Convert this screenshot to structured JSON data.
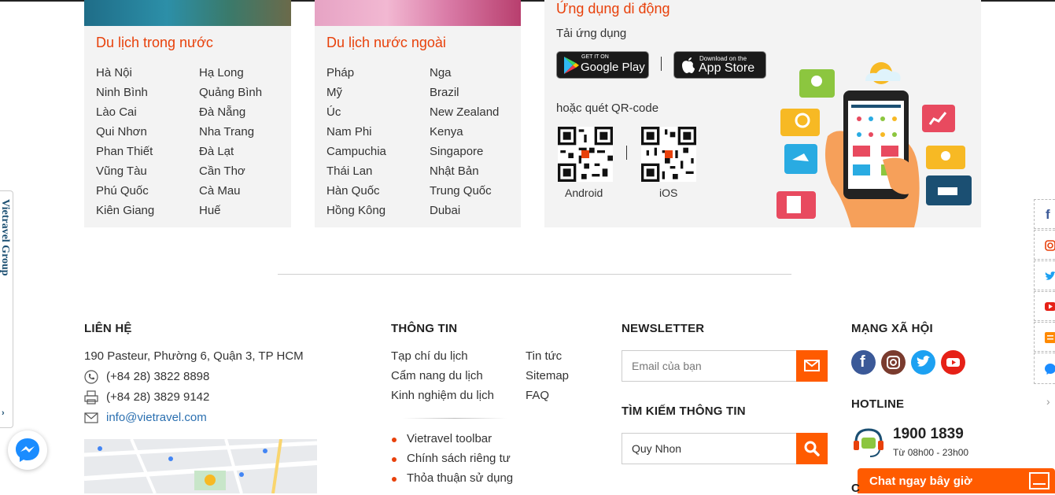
{
  "domestic": {
    "title": "Du lịch trong nước",
    "col1": [
      "Hà Nội",
      "Ninh Bình",
      "Lào Cai",
      "Qui Nhơn",
      "Phan Thiết",
      "Vũng Tàu",
      "Phú Quốc",
      "Kiên Giang"
    ],
    "col2": [
      "Hạ Long",
      "Quảng Bình",
      "Đà Nẵng",
      "Nha Trang",
      "Đà Lạt",
      "Cần Thơ",
      "Cà Mau",
      "Huế"
    ]
  },
  "international": {
    "title": "Du lịch nước ngoài",
    "col1": [
      "Pháp",
      "Mỹ",
      "Úc",
      "Nam Phi",
      "Campuchia",
      "Thái Lan",
      "Hàn Quốc",
      "Hồng Kông"
    ],
    "col2": [
      "Nga",
      "Brazil",
      "New Zealand",
      "Kenya",
      "Singapore",
      "Nhật Bản",
      "Trung Quốc",
      "Dubai"
    ]
  },
  "mobile": {
    "title": "Ứng dụng di động",
    "download_label": "Tải ứng dụng",
    "google_small": "GET IT ON",
    "google_big": "Google Play",
    "apple_small": "Download on the",
    "apple_big": "App Store",
    "qr_label": "hoặc quét QR-code",
    "android_label": "Android",
    "ios_label": "iOS"
  },
  "contact": {
    "heading": "LIÊN HỆ",
    "address": "190 Pasteur, Phường 6, Quận 3, TP HCM",
    "phone": "(+84 28) 3822 8898",
    "fax": "(+84 28) 3829 9142",
    "email": "info@vietravel.com"
  },
  "info": {
    "heading": "THÔNG TIN",
    "col1": [
      "Tạp chí du lịch",
      "Cẩm nang du lịch",
      "Kinh nghiệm du lịch"
    ],
    "col2": [
      "Tin tức",
      "Sitemap",
      "FAQ"
    ],
    "bullets": [
      "Vietravel toolbar",
      "Chính sách riêng tư",
      "Thỏa thuận sử dụng"
    ]
  },
  "newsletter": {
    "heading": "NEWSLETTER",
    "placeholder": "Email của bạn",
    "search_heading": "TÌM KIẾM THÔNG TIN",
    "search_value": "Quy Nhon"
  },
  "social": {
    "heading": "MẠNG XÃ HỘI",
    "hotline_heading": "HOTLINE",
    "hotline_number": "1900 1839",
    "hotline_hours": "Từ 08h00 - 23h00",
    "colors": {
      "facebook": "#3b5998",
      "instagram": "#7a3b2e",
      "twitter": "#1da1f2",
      "youtube": "#e62117"
    }
  },
  "side_tab": "Vietravel Group",
  "chat_label": "Chat ngay bây giờ",
  "accent": "#e8410b",
  "button_orange": "#ff5b00"
}
